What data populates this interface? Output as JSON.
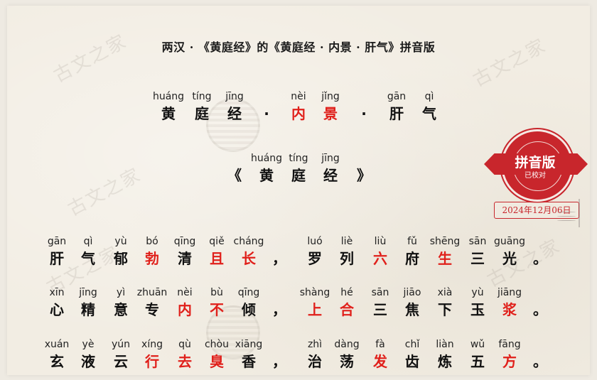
{
  "title": "两汉 · 《黄庭经》的《黄庭经 · 内景 · 肝气》拼音版",
  "watermark": "古文之家",
  "stamp": {
    "main": "拼音版",
    "sub": "已校对",
    "date": "2024年12月06日",
    "color": "#c8262c"
  },
  "colors": {
    "accent_red": "#e0201b",
    "text": "#111111",
    "paper": "#f2ede3"
  },
  "rows": [
    {
      "top": 0,
      "chars": [
        {
          "py": "huáng",
          "hz": "黄",
          "red": false
        },
        {
          "py": "tíng",
          "hz": "庭",
          "red": false
        },
        {
          "py": "jīng",
          "hz": "经",
          "red": false
        },
        {
          "py": "",
          "hz": "·",
          "red": false
        },
        {
          "py": "nèi",
          "hz": "内",
          "red": true
        },
        {
          "py": "jǐng",
          "hz": "景",
          "red": true
        },
        {
          "py": "",
          "hz": "·",
          "red": false
        },
        {
          "py": "gān",
          "hz": "肝",
          "red": false
        },
        {
          "py": "qì",
          "hz": "气",
          "red": false
        }
      ]
    },
    {
      "chars": [
        {
          "py": "",
          "hz": "《",
          "red": false
        },
        {
          "py": "huáng",
          "hz": "黄",
          "red": false
        },
        {
          "py": "tíng",
          "hz": "庭",
          "red": false
        },
        {
          "py": "jīng",
          "hz": "经",
          "red": false
        },
        {
          "py": "",
          "hz": "》",
          "red": false
        }
      ]
    },
    {
      "chars": [
        {
          "py": "gān",
          "hz": "肝",
          "red": false
        },
        {
          "py": "qì",
          "hz": "气",
          "red": false
        },
        {
          "py": "yù",
          "hz": "郁",
          "red": false
        },
        {
          "py": "bó",
          "hz": "勃",
          "red": true
        },
        {
          "py": "qīng",
          "hz": "清",
          "red": false
        },
        {
          "py": "qiě",
          "hz": "且",
          "red": true
        },
        {
          "py": "cháng",
          "hz": "长",
          "red": true
        },
        {
          "py": "",
          "hz": "，",
          "red": false
        },
        {
          "py": "luó",
          "hz": "罗",
          "red": false
        },
        {
          "py": "liè",
          "hz": "列",
          "red": false
        },
        {
          "py": "liù",
          "hz": "六",
          "red": true
        },
        {
          "py": "fǔ",
          "hz": "府",
          "red": false
        },
        {
          "py": "shēng",
          "hz": "生",
          "red": true
        },
        {
          "py": "sān",
          "hz": "三",
          "red": false
        },
        {
          "py": "guāng",
          "hz": "光",
          "red": false
        },
        {
          "py": "",
          "hz": "。",
          "red": false
        }
      ]
    },
    {
      "chars": [
        {
          "py": "xīn",
          "hz": "心",
          "red": false
        },
        {
          "py": "jīng",
          "hz": "精",
          "red": false
        },
        {
          "py": "yì",
          "hz": "意",
          "red": false
        },
        {
          "py": "zhuān",
          "hz": "专",
          "red": false
        },
        {
          "py": "nèi",
          "hz": "内",
          "red": true
        },
        {
          "py": "bù",
          "hz": "不",
          "red": true
        },
        {
          "py": "qīng",
          "hz": "倾",
          "red": false
        },
        {
          "py": "",
          "hz": "，",
          "red": false
        },
        {
          "py": "shàng",
          "hz": "上",
          "red": true
        },
        {
          "py": "hé",
          "hz": "合",
          "red": true
        },
        {
          "py": "sān",
          "hz": "三",
          "red": false
        },
        {
          "py": "jiāo",
          "hz": "焦",
          "red": false
        },
        {
          "py": "xià",
          "hz": "下",
          "red": false
        },
        {
          "py": "yù",
          "hz": "玉",
          "red": false
        },
        {
          "py": "jiāng",
          "hz": "浆",
          "red": true
        },
        {
          "py": "",
          "hz": "。",
          "red": false
        }
      ]
    },
    {
      "chars": [
        {
          "py": "xuán",
          "hz": "玄",
          "red": false
        },
        {
          "py": "yè",
          "hz": "液",
          "red": false
        },
        {
          "py": "yún",
          "hz": "云",
          "red": false
        },
        {
          "py": "xíng",
          "hz": "行",
          "red": true
        },
        {
          "py": "qù",
          "hz": "去",
          "red": true
        },
        {
          "py": "chòu",
          "hz": "臭",
          "red": true
        },
        {
          "py": "xiāng",
          "hz": "香",
          "red": false
        },
        {
          "py": "",
          "hz": "，",
          "red": false
        },
        {
          "py": "zhì",
          "hz": "治",
          "red": false
        },
        {
          "py": "dàng",
          "hz": "荡",
          "red": false
        },
        {
          "py": "fà",
          "hz": "发",
          "red": true
        },
        {
          "py": "chǐ",
          "hz": "齿",
          "red": false
        },
        {
          "py": "liàn",
          "hz": "炼",
          "red": false
        },
        {
          "py": "wǔ",
          "hz": "五",
          "red": false
        },
        {
          "py": "fāng",
          "hz": "方",
          "red": true
        },
        {
          "py": "",
          "hz": "。",
          "red": false
        }
      ]
    }
  ]
}
